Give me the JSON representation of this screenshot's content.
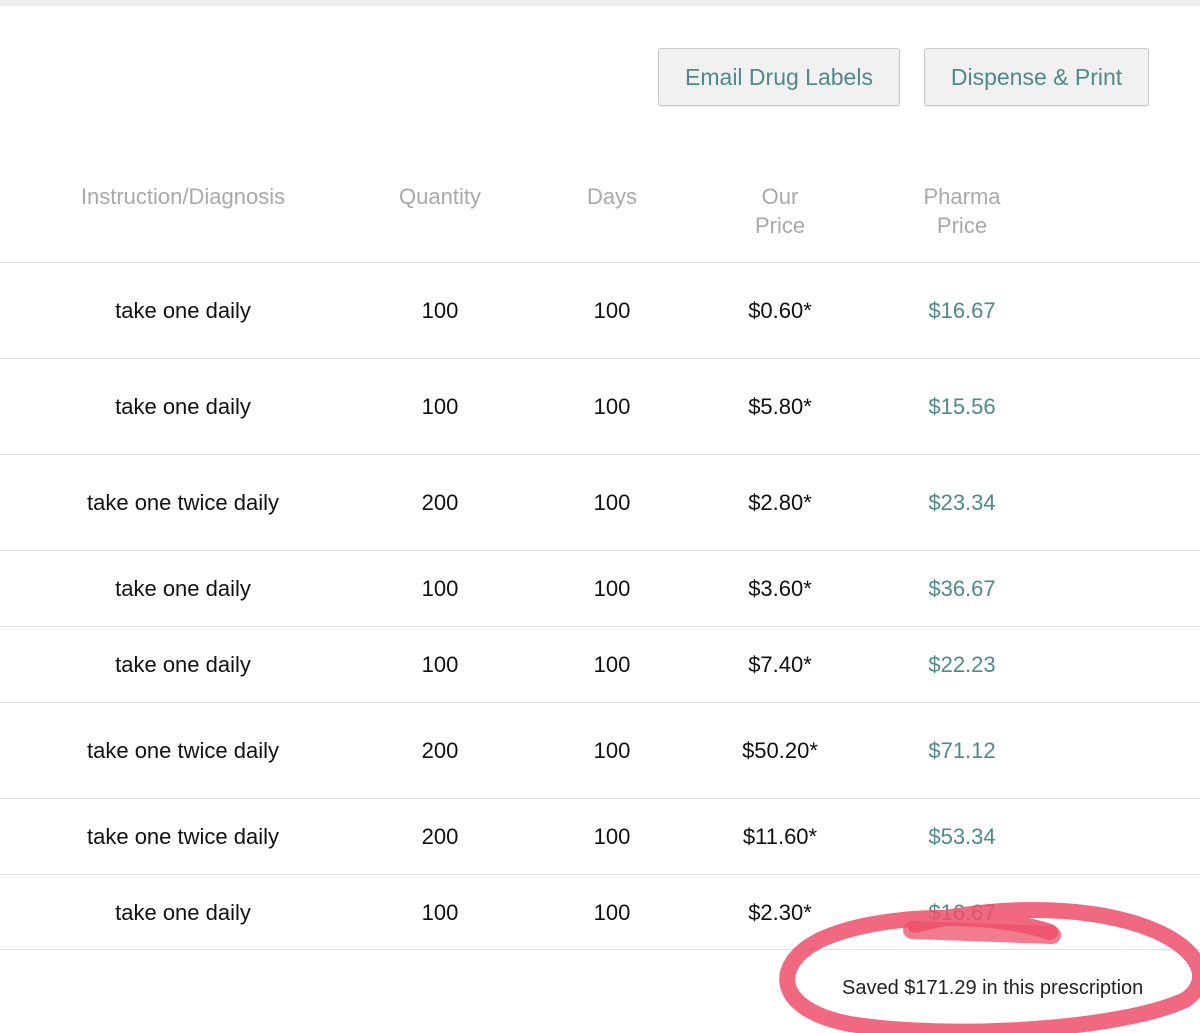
{
  "actions": {
    "email_label": "Email Drug Labels",
    "print_label": "Dispense & Print"
  },
  "table": {
    "headers": {
      "instruction": "Instruction/Diagnosis",
      "quantity": "Quantity",
      "days": "Days",
      "our_price_line1": "Our",
      "our_price_line2": "Price",
      "pharma_price_line1": "Pharma",
      "pharma_price_line2": "Price"
    },
    "rows": [
      {
        "instruction": "take one daily",
        "quantity": "100",
        "days": "100",
        "our_price": "$0.60*",
        "pharma_price": "$16.67"
      },
      {
        "instruction": "take one daily",
        "quantity": "100",
        "days": "100",
        "our_price": "$5.80*",
        "pharma_price": "$15.56"
      },
      {
        "instruction": "take one twice daily",
        "quantity": "200",
        "days": "100",
        "our_price": "$2.80*",
        "pharma_price": "$23.34"
      },
      {
        "instruction": "take one daily",
        "quantity": "100",
        "days": "100",
        "our_price": "$3.60*",
        "pharma_price": "$36.67"
      },
      {
        "instruction": "take one daily",
        "quantity": "100",
        "days": "100",
        "our_price": "$7.40*",
        "pharma_price": "$22.23"
      },
      {
        "instruction": "take one twice daily",
        "quantity": "200",
        "days": "100",
        "our_price": "$50.20*",
        "pharma_price": "$71.12"
      },
      {
        "instruction": "take one twice daily",
        "quantity": "200",
        "days": "100",
        "our_price": "$11.60*",
        "pharma_price": "$53.34"
      },
      {
        "instruction": "take one daily",
        "quantity": "100",
        "days": "100",
        "our_price": "$2.30*",
        "pharma_price": "$16.67"
      }
    ]
  },
  "summary": {
    "saved_text": "Saved $171.29 in this prescription"
  },
  "colors": {
    "accent": "#4f8a86",
    "header_text": "#a9a9a9",
    "annotation": "#ef4f6a"
  }
}
